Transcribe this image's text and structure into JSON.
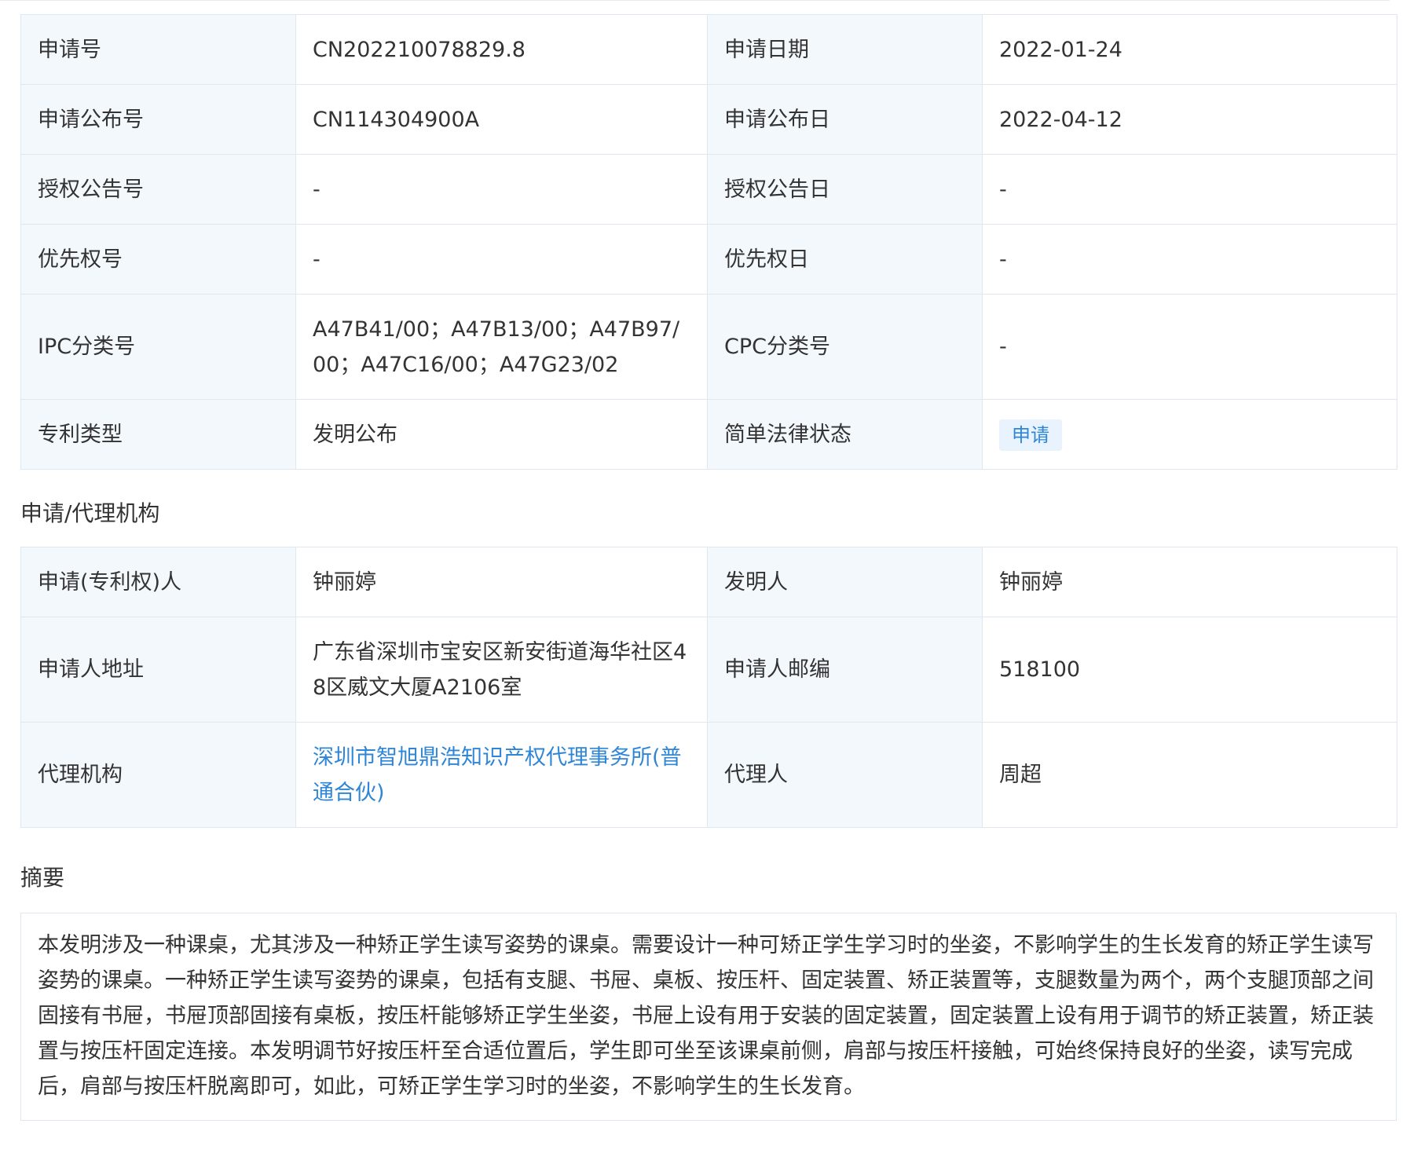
{
  "basic_info": {
    "rows": [
      {
        "label1": "申请号",
        "value1": "CN202210078829.8",
        "label2": "申请日期",
        "value2": "2022-01-24"
      },
      {
        "label1": "申请公布号",
        "value1": "CN114304900A",
        "label2": "申请公布日",
        "value2": "2022-04-12"
      },
      {
        "label1": "授权公告号",
        "value1": "-",
        "label2": "授权公告日",
        "value2": "-"
      },
      {
        "label1": "优先权号",
        "value1": "-",
        "label2": "优先权日",
        "value2": "-"
      },
      {
        "label1": "IPC分类号",
        "value1": "A47B41/00；A47B13/00；A47B97/00；A47C16/00；A47G23/02",
        "label2": "CPC分类号",
        "value2": "-"
      },
      {
        "label1": "专利类型",
        "value1": "发明公布",
        "label2": "简单法律状态",
        "value2": "申请"
      }
    ]
  },
  "agency": {
    "title": "申请/代理机构",
    "rows": [
      {
        "label1": "申请(专利权)人",
        "value1": "钟丽婷",
        "label2": "发明人",
        "value2": "钟丽婷"
      },
      {
        "label1": "申请人地址",
        "value1": "广东省深圳市宝安区新安街道海华社区48区威文大厦A2106室",
        "label2": "申请人邮编",
        "value2": "518100"
      },
      {
        "label1": "代理机构",
        "value1": "深圳市智旭鼎浩知识产权代理事务所(普通合伙)",
        "label2": "代理人",
        "value2": "周超"
      }
    ]
  },
  "abstract": {
    "title": "摘要",
    "text": "本发明涉及一种课桌，尤其涉及一种矫正学生读写姿势的课桌。需要设计一种可矫正学生学习时的坐姿，不影响学生的生长发育的矫正学生读写姿势的课桌。一种矫正学生读写姿势的课桌，包括有支腿、书屉、桌板、按压杆、固定装置、矫正装置等，支腿数量为两个，两个支腿顶部之间固接有书屉，书屉顶部固接有桌板，按压杆能够矫正学生坐姿，书屉上设有用于安装的固定装置，固定装置上设有用于调节的矫正装置，矫正装置与按压杆固定连接。本发明调节好按压杆至合适位置后，学生即可坐至该课桌前侧，肩部与按压杆接触，可始终保持良好的坐姿，读写完成后，肩部与按压杆脱离即可，如此，可矫正学生学习时的坐姿，不影响学生的生长发育。"
  },
  "colors": {
    "label_bg": "#f3f8fd",
    "border": "#dfe8f1",
    "link": "#2f86d6",
    "badge_bg": "#e8f3fd",
    "text": "#333333"
  }
}
